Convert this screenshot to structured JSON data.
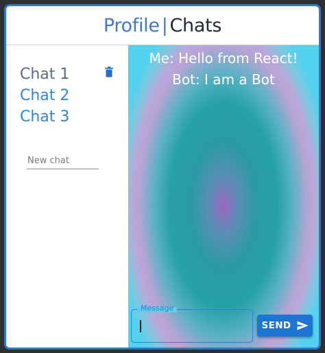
{
  "header": {
    "profile_label": "Profile",
    "separator": "|",
    "chats_label": "Chats"
  },
  "sidebar": {
    "chats": [
      {
        "label": "Chat 1"
      },
      {
        "label": "Chat 2"
      },
      {
        "label": "Chat 3"
      }
    ],
    "delete_icon": "trash-icon",
    "new_chat_placeholder": "New chat"
  },
  "conversation": {
    "messages": [
      {
        "text": "Me: Hello from React!"
      },
      {
        "text": "Bot: I am a Bot"
      }
    ]
  },
  "composer": {
    "label": "Message",
    "value": "",
    "send_label": "SEND",
    "send_icon": "send-icon"
  },
  "colors": {
    "frame_border": "#2a78d6",
    "link_blue": "#2f86d2",
    "send_button": "#1e74d2"
  }
}
